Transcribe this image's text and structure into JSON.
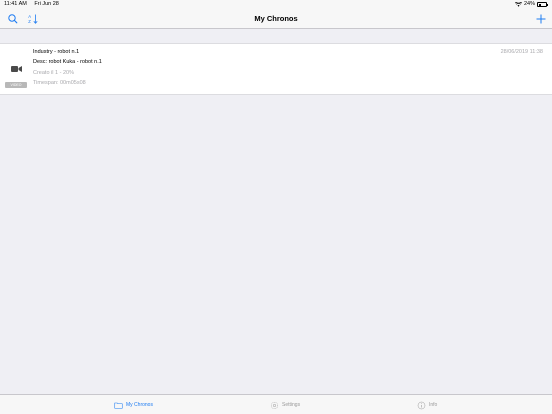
{
  "status_bar": {
    "time": "11:41 AM",
    "date": "Fri Jun 28",
    "battery": "24%"
  },
  "nav": {
    "title": "My Chronos"
  },
  "list": {
    "items": [
      {
        "title": "Industry - robot n.1",
        "description": "Desc: robot Kuka - robot n.1",
        "created": "Creato il 1 - 20%",
        "timespan": "Timespan: 00m05s08",
        "date": "28/06/2019 11:38",
        "badge": "VIDEO"
      }
    ]
  },
  "tabs": [
    {
      "label": "My Chronos",
      "icon": "folder-icon",
      "active": true
    },
    {
      "label": "Settings",
      "icon": "gear-icon",
      "active": false
    },
    {
      "label": "Info",
      "icon": "info-icon",
      "active": false
    }
  ],
  "colors": {
    "accent": "#1e7cf2",
    "background": "#efeff4",
    "muted": "#a9a9ad"
  }
}
